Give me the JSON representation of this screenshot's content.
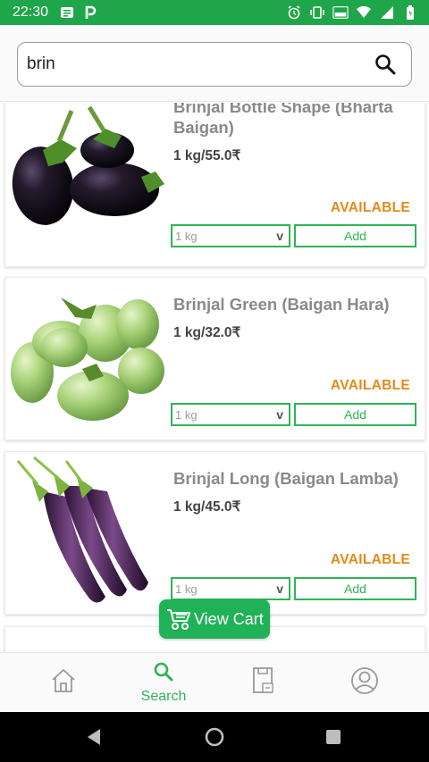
{
  "status_bar": {
    "time": "22:30",
    "left_icons": [
      "notes-icon",
      "paytm-icon"
    ],
    "right_icons": [
      "alarm-icon",
      "vibrate-icon",
      "volte-icon",
      "wifi-icon",
      "signal-icon",
      "battery-icon"
    ],
    "color": "#1fa64a"
  },
  "search": {
    "value": "brin",
    "placeholder": ""
  },
  "products": [
    {
      "name": "Brinjal Bottle Shape (Bharta Baigan)",
      "price": "1 kg/55.0₹",
      "status": "AVAILABLE",
      "quantity": "1 kg",
      "quantity_chevron": "v",
      "add_label": "Add"
    },
    {
      "name": "Brinjal Green (Baigan Hara)",
      "price": "1 kg/32.0₹",
      "status": "AVAILABLE",
      "quantity": "1 kg",
      "quantity_chevron": "v",
      "add_label": "Add"
    },
    {
      "name": "Brinjal Long (Baigan Lamba)",
      "price": "1 kg/45.0₹",
      "status": "AVAILABLE",
      "quantity": "1 kg",
      "quantity_chevron": "v",
      "add_label": "Add"
    }
  ],
  "view_cart": {
    "label": "View Cart"
  },
  "bottom_nav": {
    "items": [
      {
        "icon": "home-icon",
        "label": ""
      },
      {
        "icon": "search-icon",
        "label": "Search",
        "active": true
      },
      {
        "icon": "orders-icon",
        "label": ""
      },
      {
        "icon": "profile-icon",
        "label": ""
      }
    ]
  },
  "colors": {
    "brand_green": "#1fa64a",
    "accent_green": "#2fb456",
    "available_orange": "#e38a1a"
  }
}
